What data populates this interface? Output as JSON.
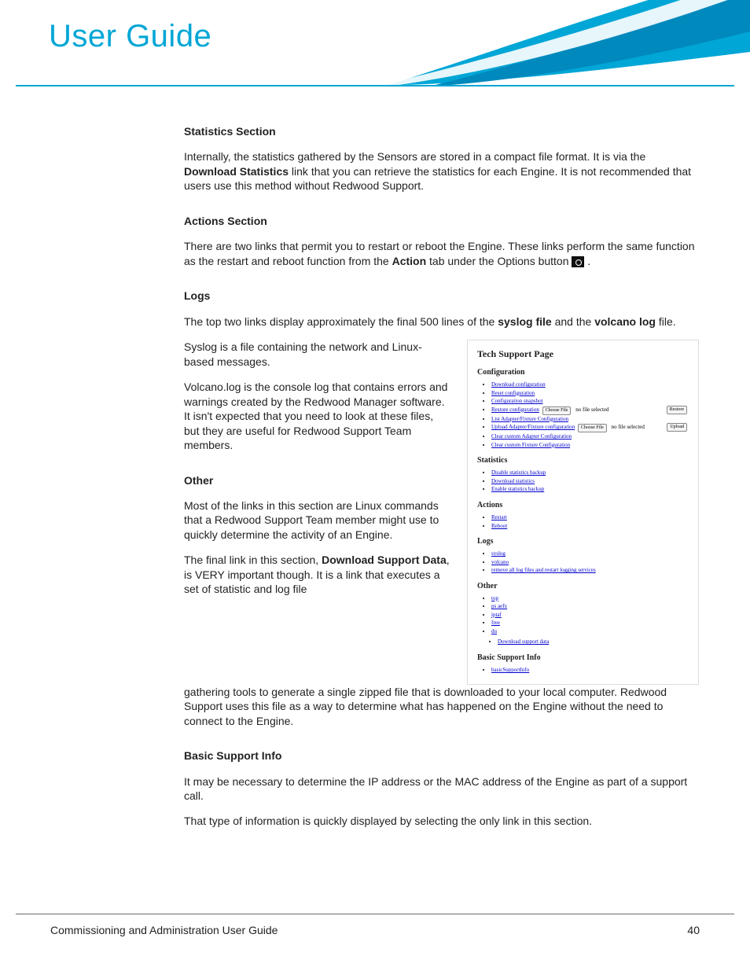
{
  "header": {
    "title": "User Guide"
  },
  "sections": {
    "stats": {
      "heading": "Statistics Section",
      "para_a": "Internally, the statistics gathered by the Sensors are stored in a compact file format. It is via the ",
      "bold_a": "Download Statistics",
      "para_b": " link that you can retrieve the statistics for each Engine. It is not recommended that users use this method without Redwood Support."
    },
    "actions": {
      "heading": "Actions Section",
      "para_a": "There are two links that permit you to restart or reboot the Engine. These links perform the same function as the restart and reboot function from the ",
      "bold_a": "Action",
      "para_b": " tab under the Options button ",
      "trail": "."
    },
    "logs": {
      "heading": "Logs",
      "para1_a": "The top two links display approximately the final 500 lines of the ",
      "bold1": "syslog file",
      "para1_b": " and the ",
      "bold2": "volcano log",
      "para1_c": " file.",
      "para2": "Syslog is a file containing the network and Linux-based messages.",
      "para3": "Volcano.log is the console log that contains errors and warnings created by the Redwood Manager software. It isn't expected that you need to look at these files, but they are useful for Redwood Support Team members."
    },
    "other": {
      "heading": "Other",
      "para1": "Most of the links in this section are Linux commands that a Redwood Support Team member might use to quickly determine the activity of an Engine.",
      "para2_a": "The final link in this section, ",
      "bold_a": "Download Support Data",
      "para2_b": ", is VERY important though. It is a link that executes a set of statistic and log file gathering tools to generate a single zipped file that is downloaded to your local computer. Redwood Support uses this file as a way to determine what has happened on the Engine without the need to connect to the Engine.",
      "para2_left": ", is VERY important though. It is a link that executes a set of statistic and log file",
      "para2_full": "gathering tools to generate a single zipped file that is downloaded to your local computer. Redwood Support uses this file as a way to determine what has happened on the Engine without the need to connect to the Engine."
    },
    "basic": {
      "heading": "Basic Support Info",
      "para1": "It may be necessary to determine the IP address or the MAC address of the Engine as part of a support call.",
      "para2": "That type of information is quickly displayed by selecting the only link in this section."
    }
  },
  "panel": {
    "title": "Tech Support Page",
    "groups": [
      {
        "heading": "Configuration",
        "items": [
          {
            "label": "Download configuration"
          },
          {
            "label": "Reset configuration"
          },
          {
            "label": "Configuration snapshot"
          },
          {
            "label": "Restore configuration",
            "btn1": "Choose File",
            "after1": "no file selected",
            "btn2": "Restore"
          },
          {
            "label": "List Adapter/Fixture Configuration"
          },
          {
            "label": "Upload Adapter/Fixture configuration",
            "btn1": "Choose File",
            "after1": "no file selected",
            "btn2": "Upload"
          },
          {
            "label": "Clear custom Adapter Configuration"
          },
          {
            "label": "Clear custom Fixture Configuration"
          }
        ]
      },
      {
        "heading": "Statistics",
        "items": [
          {
            "label": "Disable statistics backup"
          },
          {
            "label": "Download statistics"
          },
          {
            "label": "Enable statistics backup"
          }
        ]
      },
      {
        "heading": "Actions",
        "items": [
          {
            "label": "Restart"
          },
          {
            "label": "Reboot"
          }
        ]
      },
      {
        "heading": "Logs",
        "items": [
          {
            "label": "syslog"
          },
          {
            "label": "volcano"
          },
          {
            "label": "remove all log files and restart logging services"
          }
        ]
      },
      {
        "heading": "Other",
        "items": [
          {
            "label": "top"
          },
          {
            "label": "ps aefx"
          },
          {
            "label": "iptaf"
          },
          {
            "label": "free"
          },
          {
            "label": "du"
          }
        ],
        "subitems": [
          {
            "label": "Download support data"
          }
        ]
      },
      {
        "heading": "Basic Support Info",
        "items": [
          {
            "label": "basicSupportInfo"
          }
        ]
      }
    ]
  },
  "footer": {
    "text": "Commissioning and Administration User Guide",
    "page": "40"
  }
}
